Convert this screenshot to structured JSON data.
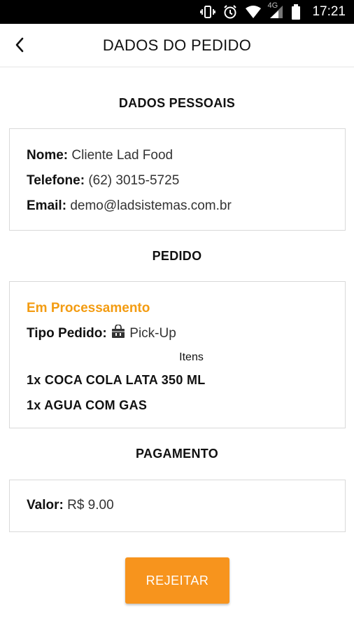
{
  "status_bar": {
    "network": "4G",
    "time": "17:21"
  },
  "header": {
    "title": "DADOS DO PEDIDO"
  },
  "personal": {
    "section_title": "DADOS PESSOAIS",
    "name_label": "Nome:",
    "name_value": "Cliente Lad Food",
    "phone_label": "Telefone:",
    "phone_value": "(62) 3015-5725",
    "email_label": "Email:",
    "email_value": "demo@ladsistemas.com.br"
  },
  "order": {
    "section_title": "PEDIDO",
    "status": "Em Processamento",
    "status_color": "#f39c12",
    "type_label": "Tipo Pedido:",
    "type_icon": "shopping-bag-icon",
    "type_value": "Pick-Up",
    "items_label": "Itens",
    "items": [
      "1x COCA COLA LATA 350 ML",
      "1x AGUA COM GAS"
    ]
  },
  "payment": {
    "section_title": "PAGAMENTO",
    "value_label": "Valor:",
    "value": "R$ 9.00"
  },
  "actions": {
    "reject_label": "REJEITAR",
    "reject_color": "#f7941d"
  }
}
